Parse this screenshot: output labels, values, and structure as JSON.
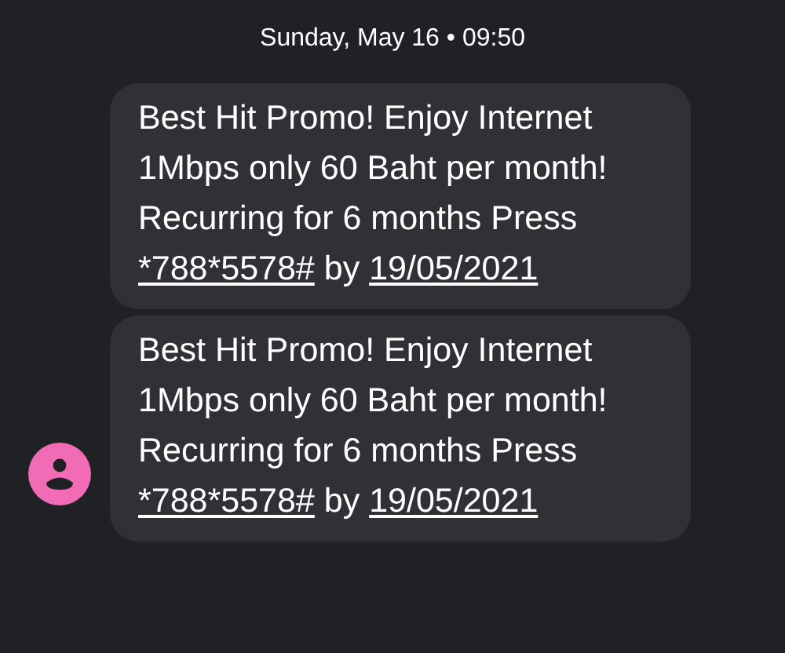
{
  "timestamp": "Sunday, May 16 • 09:50",
  "messages": [
    {
      "parts": [
        {
          "kind": "text",
          "text": "Best Hit Promo! Enjoy Internet 1Mbps only 60 Baht per month! Recurring for 6 months Press "
        },
        {
          "kind": "link",
          "text": "*788*5578#"
        },
        {
          "kind": "text",
          "text": " by "
        },
        {
          "kind": "link",
          "text": "19/05/2021"
        }
      ]
    },
    {
      "parts": [
        {
          "kind": "text",
          "text": "Best Hit Promo! Enjoy Internet 1Mbps only 60 Baht per month! Recurring for 6 months Press "
        },
        {
          "kind": "link",
          "text": "*788*5578#"
        },
        {
          "kind": "text",
          "text": " by "
        },
        {
          "kind": "link",
          "text": "19/05/2021"
        }
      ]
    }
  ]
}
